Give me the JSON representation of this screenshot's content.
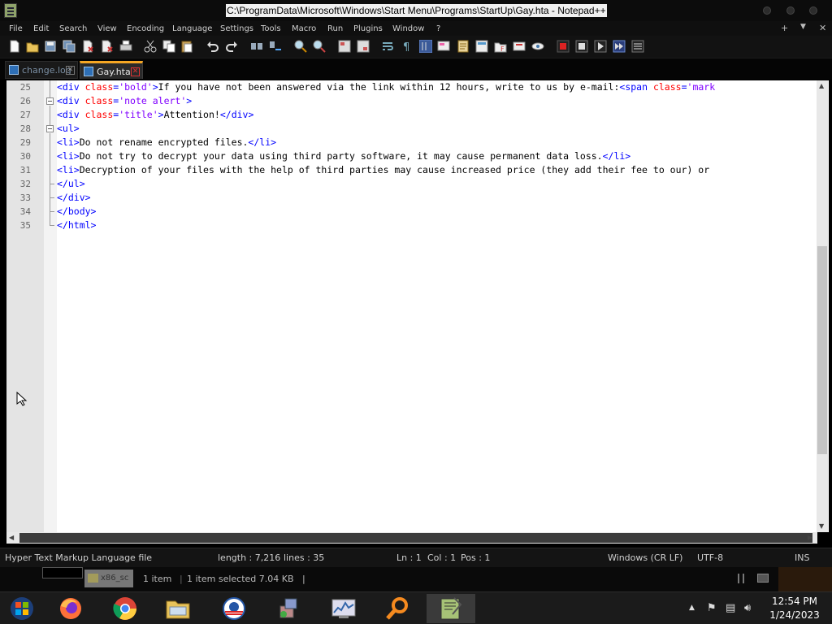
{
  "window": {
    "title": "C:\\ProgramData\\Microsoft\\Windows\\Start Menu\\Programs\\StartUp\\Gay.hta - Notepad++"
  },
  "menu": [
    "File",
    "Edit",
    "Search",
    "View",
    "Encoding",
    "Language",
    "Settings",
    "Tools",
    "Macro",
    "Run",
    "Plugins",
    "Window",
    "?"
  ],
  "menu_right": [
    "+",
    "▼",
    "✕"
  ],
  "tabs": [
    {
      "label": "change.log",
      "active": false
    },
    {
      "label": "Gay.hta",
      "active": true
    }
  ],
  "editor": {
    "lines": [
      {
        "num": "25",
        "segments": [
          {
            "t": "tag",
            "v": "<div "
          },
          {
            "t": "attr",
            "v": "class"
          },
          {
            "t": "tag",
            "v": "="
          },
          {
            "t": "val",
            "v": "'bold'"
          },
          {
            "t": "tag",
            "v": ">"
          },
          {
            "t": "txt",
            "v": "If you have not been answered via the link within 12 hours, write to us by e-mail:"
          },
          {
            "t": "tag",
            "v": "<span "
          },
          {
            "t": "attr",
            "v": "class"
          },
          {
            "t": "tag",
            "v": "="
          },
          {
            "t": "val",
            "v": "'mark"
          }
        ]
      },
      {
        "num": "26",
        "segments": [
          {
            "t": "tag",
            "v": "<div "
          },
          {
            "t": "attr",
            "v": "class"
          },
          {
            "t": "tag",
            "v": "="
          },
          {
            "t": "val",
            "v": "'note alert'"
          },
          {
            "t": "tag",
            "v": ">"
          }
        ]
      },
      {
        "num": "27",
        "segments": [
          {
            "t": "tag",
            "v": "<div "
          },
          {
            "t": "attr",
            "v": "class"
          },
          {
            "t": "tag",
            "v": "="
          },
          {
            "t": "val",
            "v": "'title'"
          },
          {
            "t": "tag",
            "v": ">"
          },
          {
            "t": "txt",
            "v": "Attention!"
          },
          {
            "t": "tag",
            "v": "</div>"
          }
        ]
      },
      {
        "num": "28",
        "segments": [
          {
            "t": "tag",
            "v": "<ul>"
          }
        ]
      },
      {
        "num": "29",
        "segments": [
          {
            "t": "tag",
            "v": "<li>"
          },
          {
            "t": "txt",
            "v": "Do not rename encrypted files."
          },
          {
            "t": "tag",
            "v": "</li>"
          }
        ]
      },
      {
        "num": "30",
        "segments": [
          {
            "t": "tag",
            "v": "<li>"
          },
          {
            "t": "txt",
            "v": "Do not try to decrypt your data using third party software, it may cause permanent data loss."
          },
          {
            "t": "tag",
            "v": "</li>"
          }
        ]
      },
      {
        "num": "31",
        "segments": [
          {
            "t": "tag",
            "v": "<li>"
          },
          {
            "t": "txt",
            "v": "Decryption of your files with the help of third parties may cause increased price (they add their fee to our) or"
          }
        ]
      },
      {
        "num": "32",
        "segments": [
          {
            "t": "tag",
            "v": "</ul>"
          }
        ]
      },
      {
        "num": "33",
        "segments": [
          {
            "t": "tag",
            "v": "</div>"
          }
        ]
      },
      {
        "num": "34",
        "segments": [
          {
            "t": "tag",
            "v": "</body>"
          }
        ]
      },
      {
        "num": "35",
        "segments": [
          {
            "t": "tag",
            "v": "</html>"
          }
        ]
      }
    ]
  },
  "status": {
    "file_type": "Hyper Text Markup Language file",
    "length": "length : 7,216",
    "lines": "lines : 35",
    "ln": "Ln : 1",
    "col": "Col : 1",
    "pos": "Pos : 1",
    "eol": "Windows (CR LF)",
    "encoding": "UTF-8",
    "mode": "INS"
  },
  "explorer_strip": {
    "file": "x86_sc",
    "items": "1 item",
    "selected": "1 item selected  7.04 KB"
  },
  "taskbar": {
    "time": "12:54 PM",
    "date": "1/24/2023",
    "apps": [
      "windows-start",
      "firefox",
      "chrome",
      "file-explorer",
      "obama-campaign",
      "install-package",
      "performance-monitor",
      "search-tool",
      "notepad-plus-plus"
    ]
  },
  "colors": {
    "tag": "#0000ff",
    "attribute": "#ff0000",
    "attribute_value": "#8000ff",
    "active_tab_accent": "#f5a623"
  }
}
